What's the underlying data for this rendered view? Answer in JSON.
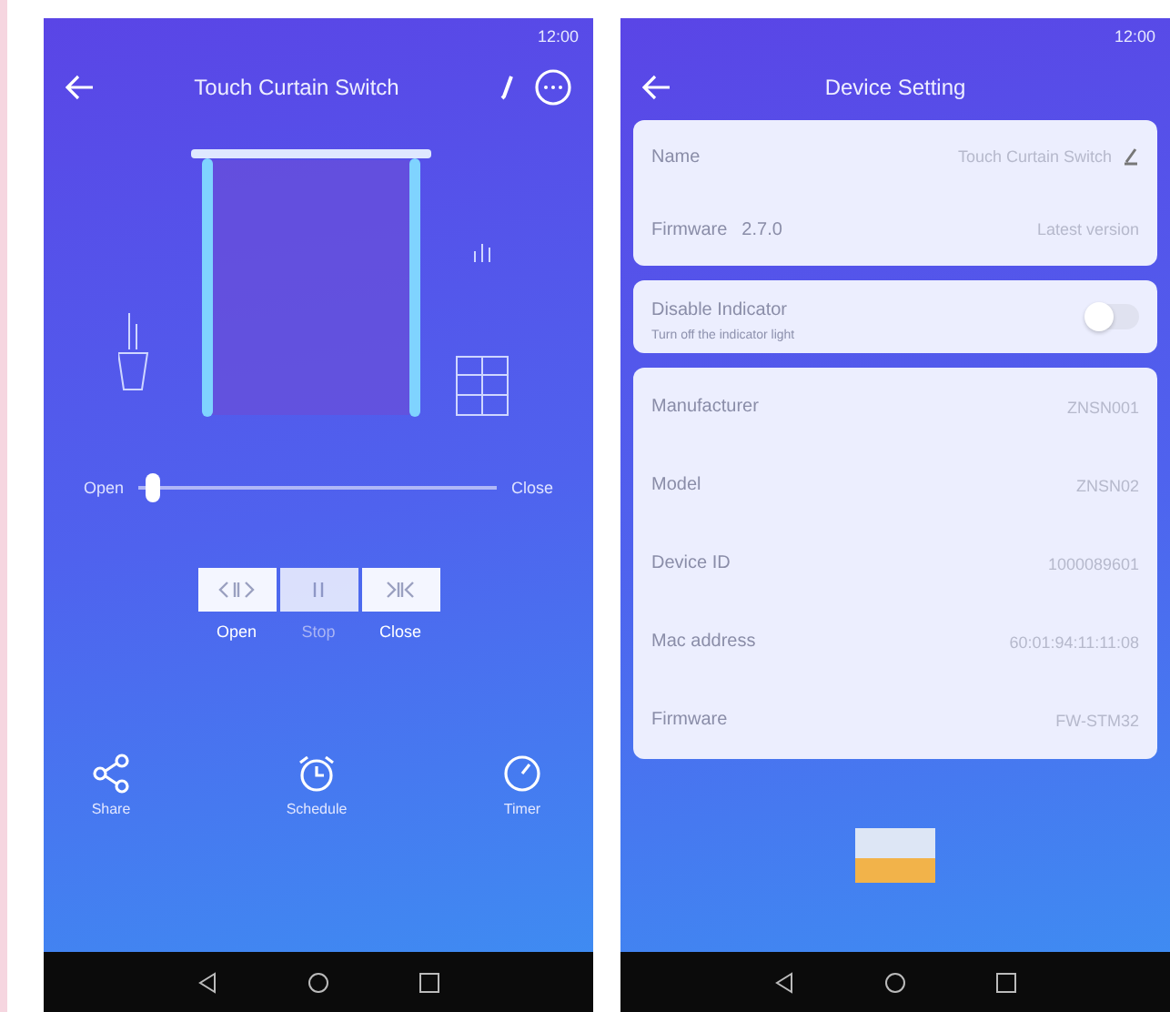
{
  "curtain_screen": {
    "status_bar": {
      "time": "12:00"
    },
    "title": "Touch Curtain Switch",
    "slider": {
      "start_label": "Open",
      "end_label": "Close",
      "level": 0.02
    },
    "controls": [
      {
        "kind": "open",
        "label": "Open",
        "disabled": false
      },
      {
        "kind": "stop",
        "label": "Stop",
        "disabled": true
      },
      {
        "kind": "close",
        "label": "Close",
        "disabled": false
      }
    ],
    "bottom_actions": [
      {
        "kind": "share",
        "label": "Share"
      },
      {
        "kind": "schedule",
        "label": "Schedule"
      },
      {
        "kind": "timer",
        "label": "Timer"
      }
    ]
  },
  "settings_screen": {
    "status_bar": {
      "time": "12:00"
    },
    "title": "Device Setting",
    "name_card": {
      "name_label": "Name",
      "name_value": "Touch Curtain Switch",
      "firmware_label": "Firmware",
      "firmware_version": "2.7.0",
      "firmware_status": "Latest version"
    },
    "indicator": {
      "label": "Disable Indicator",
      "description": "Turn off the indicator light",
      "on": false
    },
    "info_rows": [
      {
        "label": "Manufacturer",
        "value": "ZNSN001"
      },
      {
        "label": "Model",
        "value": "ZNSN02"
      },
      {
        "label": "Device ID",
        "value": "1000089601"
      },
      {
        "label": "Mac address",
        "value": "60:01:94:11:11:08"
      },
      {
        "label": "Firmware",
        "value": "FW-STM32"
      }
    ]
  }
}
